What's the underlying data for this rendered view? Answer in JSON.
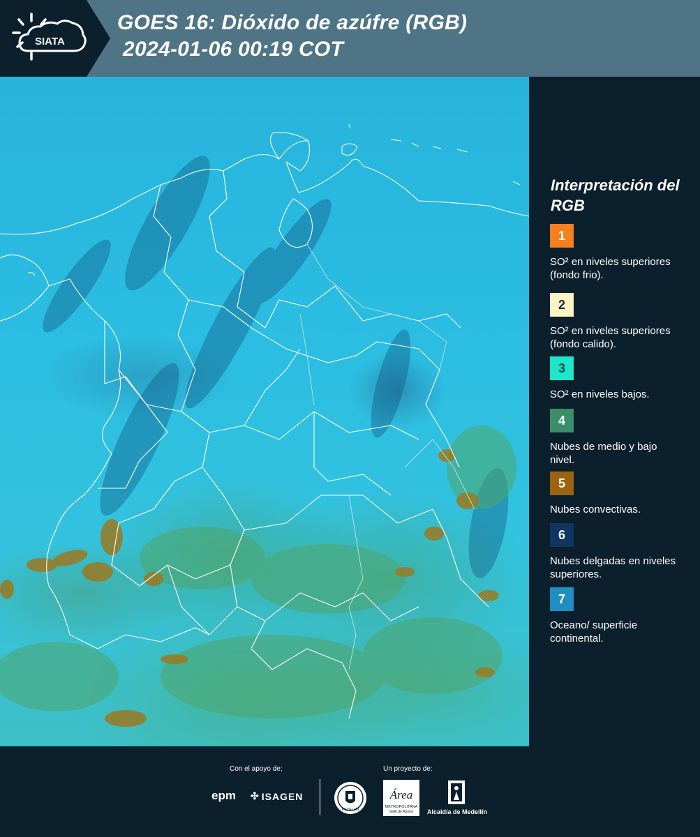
{
  "header": {
    "logo_text": "SIATA",
    "title_line1": "GOES 16: Dióxido de azúfre (RGB)",
    "title_line2": "2024-01-06 00:19 COT"
  },
  "legend": {
    "title": "Interpretación del RGB",
    "items": [
      {
        "number": "1",
        "color": "#f5801f",
        "text_color": "#ffffff",
        "label": "SO² en niveles superiores (fondo frio)."
      },
      {
        "number": "2",
        "color": "#fbf3c4",
        "text_color": "#1a2a36",
        "label": "SO² en niveles superiores (fondo calido)."
      },
      {
        "number": "3",
        "color": "#1de7c8",
        "text_color": "#1a4a4a",
        "label": "SO² en niveles bajos."
      },
      {
        "number": "4",
        "color": "#3a8f6a",
        "text_color": "#ffffff",
        "label": "Nubes de medio y bajo nivel."
      },
      {
        "number": "5",
        "color": "#9a6410",
        "text_color": "#ffffff",
        "label": "Nubes convectivas."
      },
      {
        "number": "6",
        "color": "#0f3560",
        "text_color": "#ffffff",
        "label": "Nubes delgadas en niveles superiores."
      },
      {
        "number": "7",
        "color": "#1f8fc0",
        "text_color": "#ffffff",
        "label": "Oceano/ superficie continental."
      }
    ]
  },
  "footer": {
    "support_label": "Con el apoyo de:",
    "project_label": "Un proyecto de:",
    "sponsors": [
      "epm",
      "ISAGEN"
    ],
    "area_logo_text": "Área",
    "area_logo_subtext": "METROPOLITANA",
    "area_logo_subtext2": "Valle de Aburrá",
    "seal_text": "MEDELLÍN",
    "alcaldia": "Alcaldía de Medellín"
  }
}
